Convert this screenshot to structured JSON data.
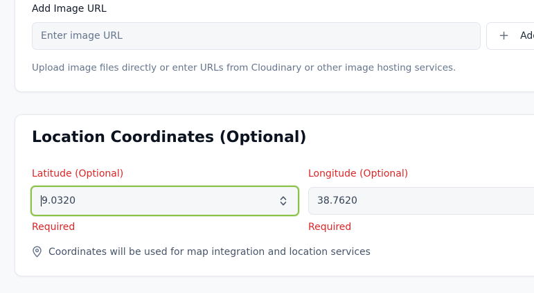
{
  "image_section": {
    "label": "Add Image URL",
    "url_input": {
      "value": "",
      "placeholder": "Enter image URL"
    },
    "add_button": {
      "icon": "plus-icon",
      "label": "Add"
    },
    "helper_text": "Upload image files directly or enter URLs from Cloudinary or other image hosting services."
  },
  "location_section": {
    "title": "Location Coordinates (Optional)",
    "latitude": {
      "label": "Latitude (Optional)",
      "value": "9.0320",
      "error": "Required"
    },
    "longitude": {
      "label": "Longitude (Optional)",
      "value": "38.7620",
      "error": "Required"
    },
    "info": {
      "icon": "map-pin-icon",
      "text": "Coordinates will be used for map integration and location services"
    }
  },
  "colors": {
    "error": "#dc2626",
    "focus_ring": "#8bc34a",
    "input_bg": "#f6f7f9",
    "page_bg": "#f8f9fb"
  }
}
